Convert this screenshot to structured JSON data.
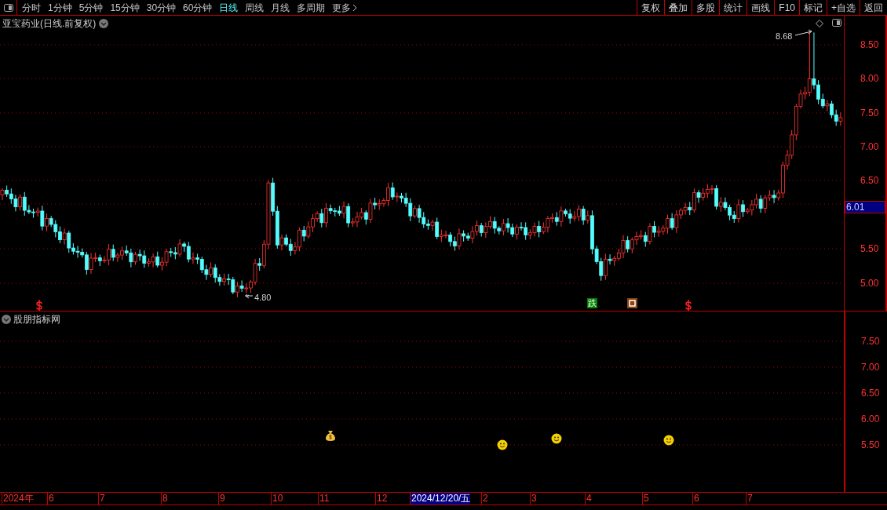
{
  "toolbar": {
    "periods": [
      {
        "label": "分时",
        "selected": false
      },
      {
        "label": "1分钟",
        "selected": false
      },
      {
        "label": "5分钟",
        "selected": false
      },
      {
        "label": "15分钟",
        "selected": false
      },
      {
        "label": "30分钟",
        "selected": false
      },
      {
        "label": "60分钟",
        "selected": false
      },
      {
        "label": "日线",
        "selected": true
      },
      {
        "label": "周线",
        "selected": false
      },
      {
        "label": "月线",
        "selected": false
      },
      {
        "label": "多周期",
        "selected": false
      },
      {
        "label": "更多",
        "selected": false
      }
    ],
    "actions": [
      "复权",
      "叠加",
      "多股",
      "统计",
      "画线",
      "F10",
      "标记",
      "+自选",
      "返回"
    ]
  },
  "main_chart": {
    "title": "亚宝药业(日线.前复权)",
    "y_labels": [
      "8.50",
      "8.00",
      "7.50",
      "7.00",
      "6.50",
      "5.50",
      "5.00"
    ],
    "current_price": "6.01",
    "high_label": "8.68",
    "low_label": "4.80",
    "signals": [
      {
        "kind": "dollar"
      },
      {
        "kind": "text",
        "text": "跌"
      },
      {
        "kind": "square"
      },
      {
        "kind": "dollar"
      }
    ]
  },
  "indicator": {
    "title": "股朋指标网",
    "y_labels": [
      "7.50",
      "7.00",
      "6.50",
      "6.00",
      "5.50"
    ],
    "markers": [
      {
        "kind": "moneybag"
      },
      {
        "kind": "smile"
      },
      {
        "kind": "smile"
      },
      {
        "kind": "smile"
      }
    ]
  },
  "date_axis": [
    {
      "label": "2024年",
      "selected": false
    },
    {
      "label": "6",
      "selected": false
    },
    {
      "label": "7",
      "selected": false
    },
    {
      "label": "8",
      "selected": false
    },
    {
      "label": "9",
      "selected": false
    },
    {
      "label": "10",
      "selected": false
    },
    {
      "label": "11",
      "selected": false
    },
    {
      "label": "12",
      "selected": false
    },
    {
      "label": "2024/12/20/五",
      "selected": true
    },
    {
      "label": "2",
      "selected": false
    },
    {
      "label": "3",
      "selected": false
    },
    {
      "label": "4",
      "selected": false
    },
    {
      "label": "5",
      "selected": false
    },
    {
      "label": "6",
      "selected": false
    },
    {
      "label": "7",
      "selected": false
    }
  ]
}
